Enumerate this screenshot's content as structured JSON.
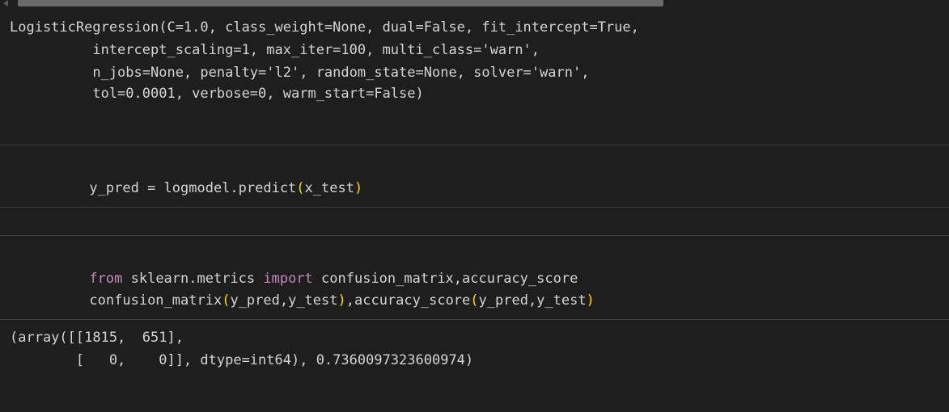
{
  "output1": {
    "lines": [
      "LogisticRegression(C=1.0, class_weight=None, dual=False, fit_intercept=True,",
      "          intercept_scaling=1, max_iter=100, multi_class='warn',",
      "          n_jobs=None, penalty='l2', random_state=None, solver='warn',",
      "          tol=0.0001, verbose=0, warm_start=False)"
    ]
  },
  "cell2": {
    "line1": {
      "a": "y_pred = logmodel.predict",
      "p1": "(",
      "b": "x_test",
      "p2": ")"
    }
  },
  "cell3": {
    "line1": {
      "kw1": "from",
      "a": " sklearn.metrics ",
      "kw2": "import",
      "b": " confusion_matrix,accuracy_score"
    },
    "line2": {
      "a": "confusion_matrix",
      "p1": "(",
      "b": "y_pred,y_test",
      "p2": ")",
      "c": ",accuracy_score",
      "p3": "(",
      "d": "y_pred,y_test",
      "p4": ")"
    }
  },
  "output3": {
    "lines": [
      "(array([[1815,  651],",
      "        [   0,    0]], dtype=int64), 0.7360097323600974)"
    ]
  }
}
